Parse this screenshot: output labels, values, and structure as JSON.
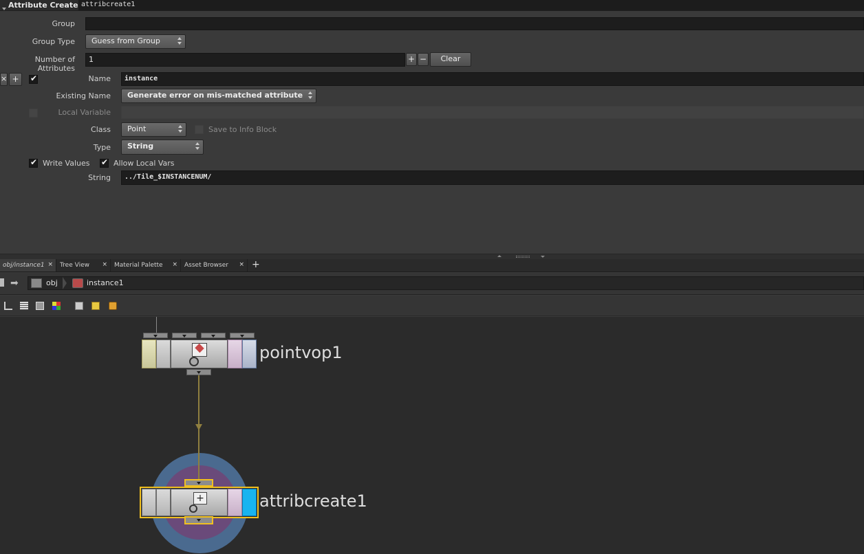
{
  "operator": {
    "type_label": "Attribute Create",
    "node_name": "attribcreate1"
  },
  "params": {
    "group": {
      "label": "Group",
      "value": ""
    },
    "group_type": {
      "label": "Group Type",
      "value": "Guess from Group"
    },
    "num_attributes": {
      "label": "Number of Attributes",
      "value": "1",
      "plus": "+",
      "minus": "−",
      "clear": "Clear"
    },
    "multiparm": {
      "remove": "×",
      "add": "+"
    },
    "name": {
      "label": "Name",
      "value": "instance"
    },
    "existing_name": {
      "label": "Existing Name",
      "value": "Generate error on mis-matched attribute"
    },
    "local_variable": {
      "label": "Local Variable",
      "value": ""
    },
    "class": {
      "label": "Class",
      "value": "Point"
    },
    "save_info": {
      "label": "Save to Info Block"
    },
    "type": {
      "label": "Type",
      "value": "String"
    },
    "write_values": {
      "label": "Write Values"
    },
    "allow_local_vars": {
      "label": "Allow Local Vars"
    },
    "string": {
      "label": "String",
      "value": "../Tile_$INSTANCENUM/"
    }
  },
  "tabs": [
    {
      "label": "obj/instance1",
      "close": "×"
    },
    {
      "label": "Tree View",
      "close": "×"
    },
    {
      "label": "Material Palette",
      "close": "×"
    },
    {
      "label": "Asset Browser",
      "close": "×"
    }
  ],
  "add_tab": "+",
  "path": {
    "root": "obj",
    "child": "instance1"
  },
  "nodes": [
    {
      "name": "pointvop1"
    },
    {
      "name": "attribcreate1"
    }
  ],
  "colors": {
    "selected_outline": "#f0c020",
    "display_flag": "#18b4f0",
    "wire": "#8f7f3f",
    "halo_outer": "#4a6a8f",
    "halo_inner": "#6a4a7a"
  }
}
